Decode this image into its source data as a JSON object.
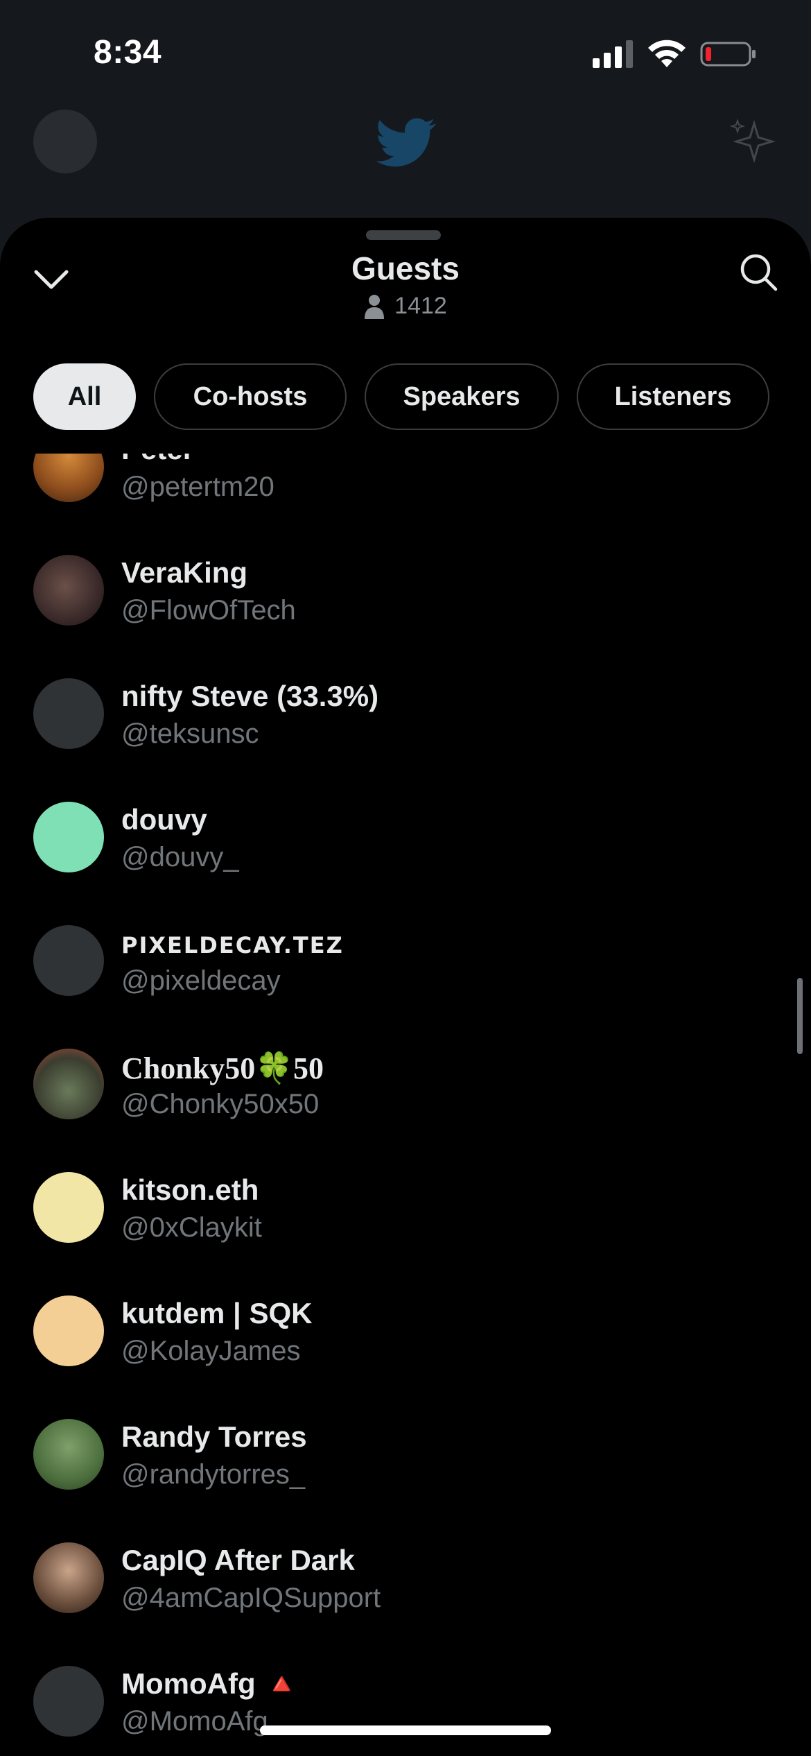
{
  "status_bar": {
    "time": "8:34"
  },
  "sheet": {
    "title": "Guests",
    "listener_count": "1412"
  },
  "filters": [
    {
      "label": "All",
      "active": true
    },
    {
      "label": "Co-hosts",
      "active": false
    },
    {
      "label": "Speakers",
      "active": false
    },
    {
      "label": "Listeners",
      "active": false
    }
  ],
  "guests": [
    {
      "name": "Peter",
      "handle": "@petertm20"
    },
    {
      "name": "VeraKing",
      "handle": "@FlowOfTech"
    },
    {
      "name": "nifty Steve (33.3%)",
      "handle": "@teksunsc"
    },
    {
      "name": "douvy",
      "handle": "@douvy_"
    },
    {
      "name": "PIXELDECAY.TEZ",
      "handle": "@pixeldecay"
    },
    {
      "name": "Chonky50🍀50",
      "handle": "@Chonky50x50"
    },
    {
      "name": "kitson.eth",
      "handle": "@0xClaykit"
    },
    {
      "name": "kutdem | SQK",
      "handle": "@KolayJames"
    },
    {
      "name": "Randy Torres",
      "handle": "@randytorres_"
    },
    {
      "name": "CapIQ After Dark",
      "handle": "@4amCapIQSupport"
    },
    {
      "name": "MomoAfg 🔺",
      "handle": "@MomoAfg"
    }
  ],
  "icons": {
    "collapse": "chevron-down-icon",
    "search": "search-icon",
    "listener": "person-icon"
  },
  "colors": {
    "sheet_bg": "#000000",
    "primary_text": "#e7e9ea",
    "secondary_text": "#71767b",
    "chip_border": "#3a3d40",
    "battery_low": "#f4212e"
  }
}
